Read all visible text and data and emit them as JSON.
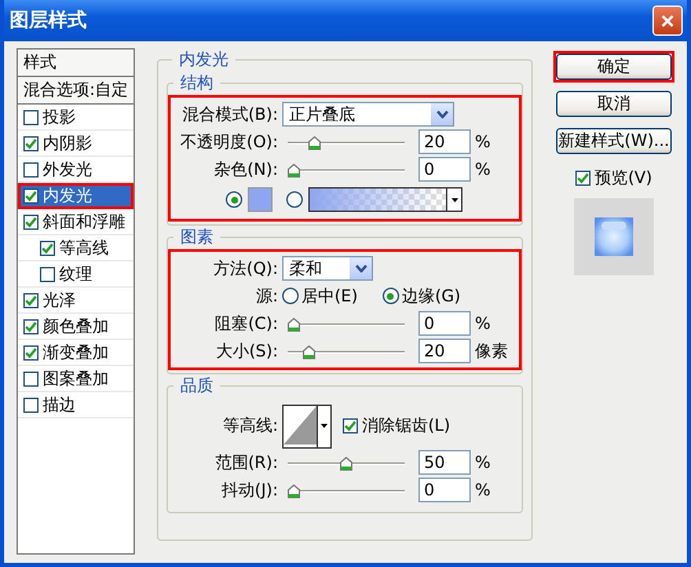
{
  "window": {
    "title": "图层样式",
    "close": "×"
  },
  "sidebar": {
    "header": "样式",
    "blend_options": "混合选项:自定",
    "items": [
      {
        "label": "投影",
        "checked": false,
        "selected": false
      },
      {
        "label": "内阴影",
        "checked": true,
        "selected": false
      },
      {
        "label": "外发光",
        "checked": false,
        "selected": false
      },
      {
        "label": "内发光",
        "checked": true,
        "selected": true
      },
      {
        "label": "斜面和浮雕",
        "checked": true,
        "selected": false,
        "children": [
          {
            "label": "等高线",
            "checked": true,
            "selected": false
          },
          {
            "label": "纹理",
            "checked": false,
            "selected": false
          }
        ]
      },
      {
        "label": "光泽",
        "checked": true,
        "selected": false
      },
      {
        "label": "颜色叠加",
        "checked": true,
        "selected": false
      },
      {
        "label": "渐变叠加",
        "checked": true,
        "selected": false
      },
      {
        "label": "图案叠加",
        "checked": false,
        "selected": false
      },
      {
        "label": "描边",
        "checked": false,
        "selected": false
      }
    ]
  },
  "panel": {
    "title": "内发光",
    "groups": [
      {
        "title": "结构",
        "highlighted": true,
        "rows": [
          {
            "kind": "select",
            "label": "混合模式(B):",
            "value": "正片叠底"
          },
          {
            "kind": "slider",
            "label": "不透明度(O):",
            "level": 0.2,
            "value": "20",
            "unit": "%"
          },
          {
            "kind": "slider",
            "label": "杂色(N):",
            "level": 0,
            "value": "0",
            "unit": "%"
          },
          {
            "kind": "fill",
            "options": [
              {
                "kind": "color",
                "selected": true,
                "color": "#8ea6f0"
              },
              {
                "kind": "gradient",
                "selected": false,
                "color": "#8ea6f0"
              }
            ]
          }
        ]
      },
      {
        "title": "图素",
        "highlighted": true,
        "rows": [
          {
            "kind": "select",
            "label": "方法(Q):",
            "value": "柔和"
          },
          {
            "kind": "radio",
            "label": "源:",
            "options": [
              {
                "label": "居中(E)",
                "selected": false
              },
              {
                "label": "边缘(G)",
                "selected": true
              }
            ]
          },
          {
            "kind": "slider",
            "label": "阻塞(C):",
            "level": 0,
            "value": "0",
            "unit": "%"
          },
          {
            "kind": "slider",
            "label": "大小(S):",
            "level": 0.15,
            "value": "20",
            "unit": "像素"
          }
        ]
      },
      {
        "title": "品质",
        "highlighted": false,
        "rows": [
          {
            "kind": "contour",
            "label": "等高线:",
            "checkbox": {
              "label": "消除锯齿(L)",
              "checked": true
            }
          },
          {
            "kind": "slider",
            "label": "范围(R):",
            "level": 0.5,
            "value": "50",
            "unit": "%"
          },
          {
            "kind": "slider",
            "label": "抖动(J):",
            "level": 0,
            "value": "0",
            "unit": "%"
          }
        ]
      }
    ]
  },
  "buttons": [
    {
      "label": "确定",
      "highlighted": true
    },
    {
      "label": "取消",
      "highlighted": false
    },
    {
      "label": "新建样式(W)...",
      "highlighted": false
    }
  ],
  "preview": {
    "label": "预览(V)",
    "checked": true
  }
}
